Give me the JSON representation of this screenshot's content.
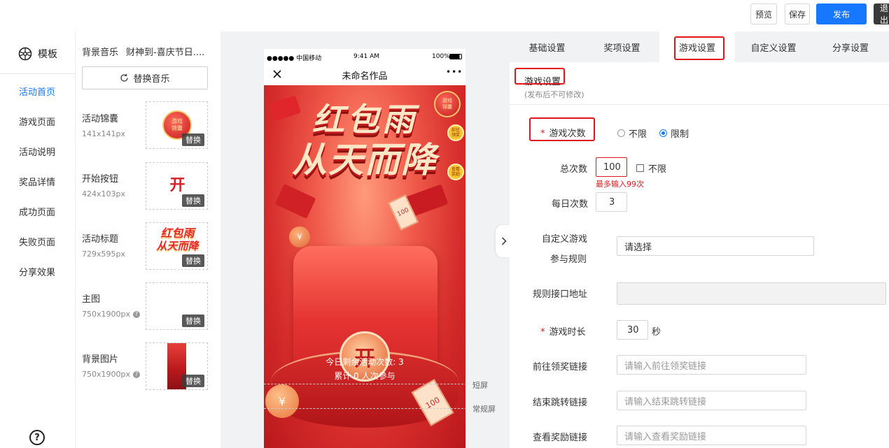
{
  "header": {
    "preview": "预览",
    "save": "保存",
    "publish": "发布",
    "exit": "退出"
  },
  "sidebar": {
    "template_label": "模板",
    "items": [
      {
        "label": "活动首页",
        "active": true
      },
      {
        "label": "游戏页面"
      },
      {
        "label": "活动说明"
      },
      {
        "label": "奖品详情"
      },
      {
        "label": "成功页面"
      },
      {
        "label": "失败页面"
      },
      {
        "label": "分享效果"
      }
    ],
    "help_icon": "?"
  },
  "assets": {
    "music_label": "背景音乐",
    "music_name": "财神到-喜庆节日....",
    "replace_music": "替换音乐",
    "replace_label": "替换",
    "items": [
      {
        "name": "活动锦囊",
        "size": "141x141px",
        "badge_text": [
          "游戏",
          "锦囊"
        ]
      },
      {
        "name": "开始按钮",
        "size": "424x103px",
        "badge_text": "开"
      },
      {
        "name": "活动标题",
        "size": "729x595px",
        "title_lines": [
          "红包雨",
          "从天而降"
        ]
      },
      {
        "name": "主图",
        "size": "750x1900px"
      },
      {
        "name": "背景图片",
        "size": "750x1900px"
      }
    ]
  },
  "phone": {
    "carrier": "●●●●● 中国移动",
    "time": "9:41 AM",
    "battery": "100%",
    "title": "未命名作品",
    "more": "•••",
    "headline_1": "红包雨",
    "headline_2": "从天而降",
    "open_char": "开",
    "coin_char": "¥",
    "ticket_text": "100",
    "side_badges": [
      [
        "游戏",
        "锦囊"
      ],
      [
        "前往",
        "领奖"
      ],
      [
        "查看",
        "奖励"
      ]
    ],
    "remaining": "今日剩余活动次数: 3",
    "participants": "累计 0 人次参与"
  },
  "guides": {
    "short": "短屏",
    "normal": "常规屏"
  },
  "settings": {
    "tabs": [
      {
        "label": "基础设置"
      },
      {
        "label": "奖项设置"
      },
      {
        "label": "游戏设置",
        "active": true
      },
      {
        "label": "自定义设置"
      },
      {
        "label": "分享设置"
      }
    ],
    "section_title": "游戏设置",
    "section_note": "(发布后不可修改)",
    "game_count": {
      "label": "游戏次数",
      "options": [
        "不限",
        "限制"
      ],
      "selected": "限制"
    },
    "total": {
      "label": "总次数",
      "value": "100",
      "unlimited": "不限",
      "error": "最多输入99次"
    },
    "daily": {
      "label": "每日次数",
      "value": "3"
    },
    "custom_rule": {
      "label_1": "自定义游戏",
      "label_2": "参与规则",
      "placeholder": "请选择"
    },
    "rule_api": {
      "label": "规则接口地址",
      "value": ""
    },
    "duration": {
      "label": "游戏时长",
      "value": "30",
      "unit": "秒"
    },
    "prize_link": {
      "label": "前往领奖链接",
      "placeholder": "请输入前往领奖链接"
    },
    "end_link": {
      "label": "结束跳转链接",
      "placeholder": "请输入结束跳转链接"
    },
    "reward_link": {
      "label": "查看奖励链接",
      "placeholder": "请输入查看奖励链接"
    }
  },
  "colors": {
    "primary": "#1677ff",
    "alert": "#e0161b",
    "scene_red": "#d42a2a",
    "gold": "#f6c86a"
  }
}
